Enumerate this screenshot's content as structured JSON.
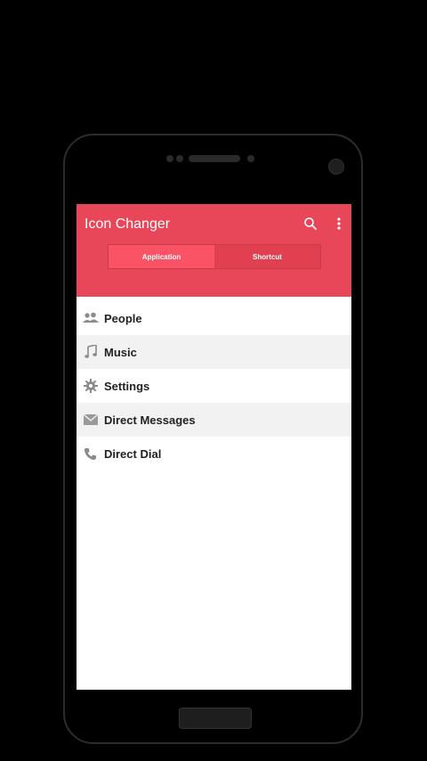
{
  "app": {
    "title": "Icon Changer",
    "accent_color": "#e84659",
    "actions": [
      {
        "icon": "search-icon"
      },
      {
        "icon": "overflow-menu-icon"
      }
    ]
  },
  "tabs": [
    {
      "label": "Application",
      "active": true
    },
    {
      "label": "Shortcut",
      "active": false
    }
  ],
  "list": [
    {
      "label": "People",
      "icon": "people-icon"
    },
    {
      "label": "Music",
      "icon": "music-note-icon"
    },
    {
      "label": "Settings",
      "icon": "gear-icon"
    },
    {
      "label": "Direct Messages",
      "icon": "envelope-icon"
    },
    {
      "label": "Direct Dial",
      "icon": "phone-icon"
    }
  ]
}
